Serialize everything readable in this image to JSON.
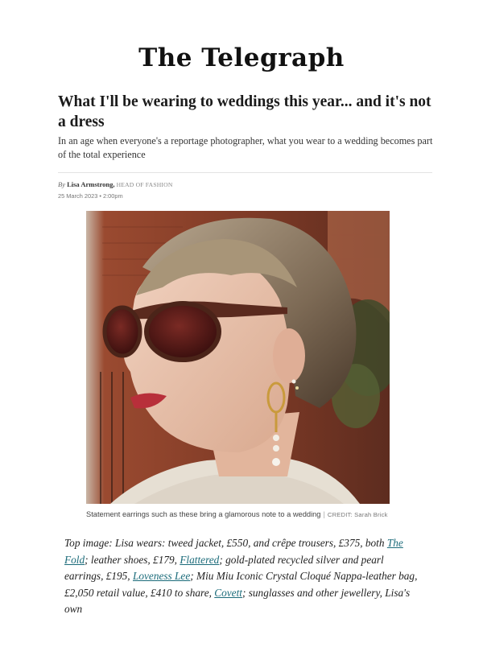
{
  "masthead": {
    "title": "The Telegraph"
  },
  "article": {
    "headline": "What I'll be wearing to weddings this year... and it's not a dress",
    "standfirst": "In an age when everyone's a reportage photographer, what you wear to a wedding becomes part of the total experience",
    "byline": {
      "prefix": "By",
      "author": "Lisa Armstrong,",
      "role": "HEAD OF FASHION",
      "date": "25 March 2023 • 2:00pm"
    },
    "image": {
      "caption": "Statement earrings such as these bring a glamorous note to a wedding",
      "separator": "|",
      "credit": "CREDIT: Sarah Brick"
    },
    "body": {
      "t1": "Top image: Lisa wears: tweed jacket, £550, and crêpe trousers, £375, both ",
      "link1": "The Fold",
      "t2": "; leather shoes, £179, ",
      "link2": "Flattered",
      "t3": "; gold-plated recycled silver and pearl earrings, £195, ",
      "link3": "Loveness Lee",
      "t4": "; Miu Miu Iconic Crystal Cloqué Nappa-leather bag, £2,050 retail value, £410 to share, ",
      "link4": "Covett",
      "t5": "; sunglasses and other jewellery, Lisa's own"
    }
  },
  "colors": {
    "link": "#1b6b7a",
    "brick": "#8a3a26"
  }
}
